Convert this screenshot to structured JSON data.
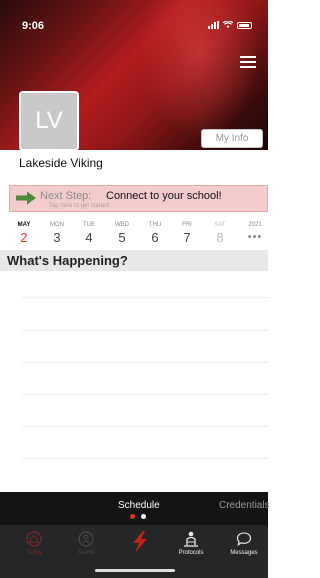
{
  "status_bar": {
    "time": "9:06"
  },
  "profile": {
    "initials": "LV",
    "my_info_label": "My Info",
    "name": "Lakeside Viking"
  },
  "next_step": {
    "prefix": "Next Step:",
    "text": "Connect to your school!",
    "subtext": "Tap here to get started"
  },
  "calendar": {
    "days": [
      {
        "name": "MAY",
        "date": "2"
      },
      {
        "name": "MON",
        "date": "3"
      },
      {
        "name": "TUE",
        "date": "4"
      },
      {
        "name": "WED",
        "date": "5"
      },
      {
        "name": "THU",
        "date": "6"
      },
      {
        "name": "FRI",
        "date": "7"
      },
      {
        "name": "SAT",
        "date": "8"
      }
    ],
    "year": "2021",
    "more": "•••"
  },
  "feed": {
    "header": "What's Happening?"
  },
  "sub_tabs": {
    "schedule": "Schedule",
    "credentials": "Credentials"
  },
  "tabbar": {
    "items": [
      {
        "label": "Today",
        "icon": "home-icon"
      },
      {
        "label": "Teams",
        "icon": "teams-icon"
      },
      {
        "label": "",
        "icon": "brand-logo-icon"
      },
      {
        "label": "Protocols",
        "icon": "protocols-icon"
      },
      {
        "label": "Messages",
        "icon": "chat-bubble-icon"
      }
    ]
  },
  "colors": {
    "accent": "#d9352e",
    "header_red": "#b31d1d",
    "next_step_bg": "#f4cccc",
    "arrow_green": "#4a8a3a",
    "tabbar_bg": "#252628"
  }
}
